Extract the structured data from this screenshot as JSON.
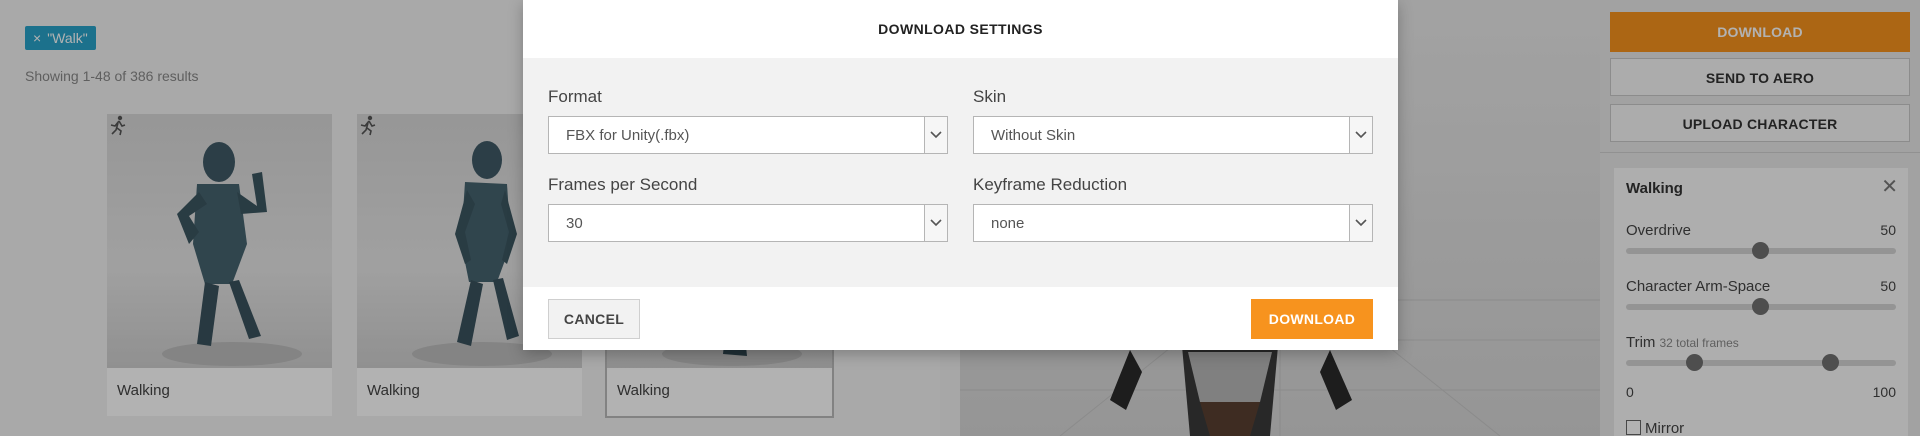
{
  "search": {
    "filter_chip": "\"Walk\"",
    "filter_chip_close": "×",
    "results_text": "Showing 1-48 of 386 results"
  },
  "animations": [
    {
      "label": "Walking"
    },
    {
      "label": "Walking"
    },
    {
      "label": "Walking"
    }
  ],
  "right_panel": {
    "download_label": "DOWNLOAD",
    "send_label": "SEND TO AERO",
    "upload_label": "UPLOAD CHARACTER",
    "animation": {
      "title": "Walking",
      "close": "✕",
      "overdrive_label": "Overdrive",
      "overdrive_value": "50",
      "arm_space_label": "Character Arm-Space",
      "arm_space_value": "50",
      "trim_label": "Trim",
      "trim_sub": "32 total frames",
      "trim_min": "0",
      "trim_max": "100",
      "mirror_label": "Mirror"
    }
  },
  "modal": {
    "title": "DOWNLOAD SETTINGS",
    "format": {
      "label": "Format",
      "value": "FBX for Unity(.fbx)"
    },
    "skin": {
      "label": "Skin",
      "value": "Without Skin"
    },
    "fps": {
      "label": "Frames per Second",
      "value": "30"
    },
    "keyframe": {
      "label": "Keyframe Reduction",
      "value": "none"
    },
    "cancel_label": "CANCEL",
    "download_label": "DOWNLOAD"
  },
  "colors": {
    "accent_orange": "#f7931e",
    "chip_blue": "#29a3c9"
  }
}
